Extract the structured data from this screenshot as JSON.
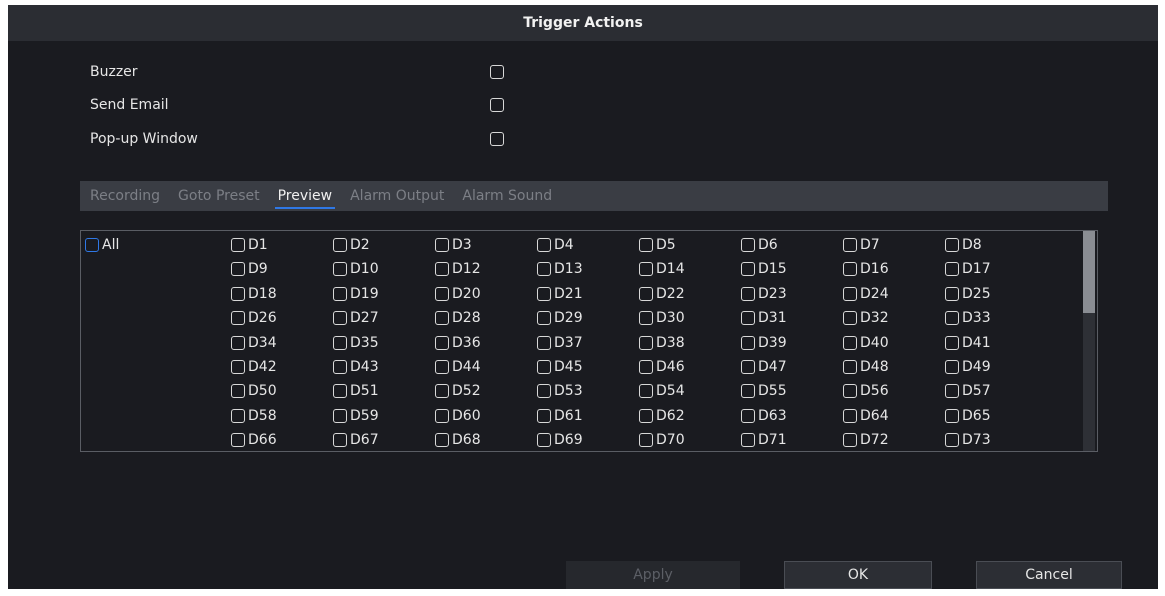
{
  "dialog": {
    "title": "Trigger Actions"
  },
  "options": [
    {
      "label": "Buzzer",
      "checked": false
    },
    {
      "label": "Send Email",
      "checked": false
    },
    {
      "label": "Pop-up Window",
      "checked": false
    }
  ],
  "tabs": [
    "Recording",
    "Goto Preset",
    "Preview",
    "Alarm Output",
    "Alarm Sound"
  ],
  "active_tab": "Preview",
  "channels": {
    "all_label": "All",
    "rows": [
      [
        "D1",
        "D2",
        "D3",
        "D4",
        "D5",
        "D6",
        "D7",
        "D8"
      ],
      [
        "D9",
        "D10",
        "D12",
        "D13",
        "D14",
        "D15",
        "D16",
        "D17"
      ],
      [
        "D18",
        "D19",
        "D20",
        "D21",
        "D22",
        "D23",
        "D24",
        "D25"
      ],
      [
        "D26",
        "D27",
        "D28",
        "D29",
        "D30",
        "D31",
        "D32",
        "D33"
      ],
      [
        "D34",
        "D35",
        "D36",
        "D37",
        "D38",
        "D39",
        "D40",
        "D41"
      ],
      [
        "D42",
        "D43",
        "D44",
        "D45",
        "D46",
        "D47",
        "D48",
        "D49"
      ],
      [
        "D50",
        "D51",
        "D52",
        "D53",
        "D54",
        "D55",
        "D56",
        "D57"
      ],
      [
        "D58",
        "D59",
        "D60",
        "D61",
        "D62",
        "D63",
        "D64",
        "D65"
      ],
      [
        "D66",
        "D67",
        "D68",
        "D69",
        "D70",
        "D71",
        "D72",
        "D73"
      ]
    ]
  },
  "buttons": {
    "apply": "Apply",
    "ok": "OK",
    "cancel": "Cancel"
  },
  "colors": {
    "accent": "#2f78e6",
    "background": "#1a1b20",
    "titlebar": "#2b2d33"
  }
}
